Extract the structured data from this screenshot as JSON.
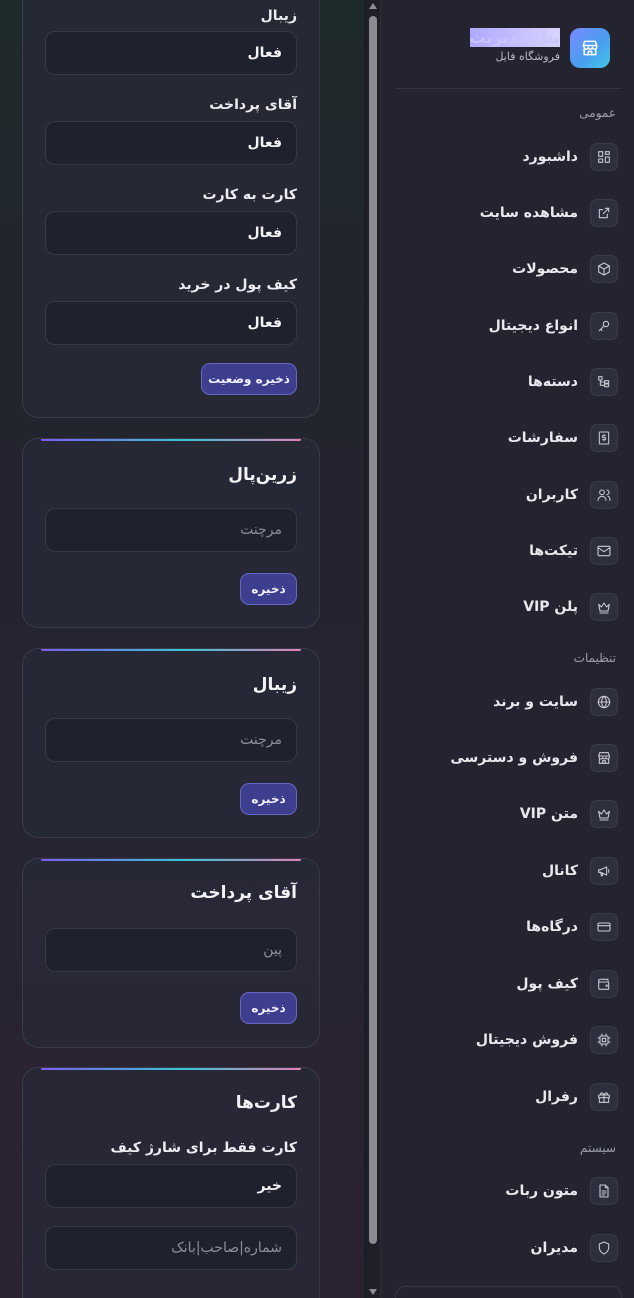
{
  "brand": {
    "title": "پنل مدیریت",
    "subtitle": "فروشگاه فایل"
  },
  "sidebar": {
    "sections": [
      {
        "label": "عمومی"
      },
      {
        "label": "تنظیمات"
      },
      {
        "label": "سیستم"
      }
    ],
    "items": [
      {
        "label": "داشبورد",
        "icon": "dashboard-icon"
      },
      {
        "label": "مشاهده سایت",
        "icon": "external-link-icon"
      },
      {
        "label": "محصولات",
        "icon": "box-icon"
      },
      {
        "label": "انواع دیجیتال",
        "icon": "key-icon"
      },
      {
        "label": "دسته‌ها",
        "icon": "category-tree-icon"
      },
      {
        "label": "سفارشات",
        "icon": "invoice-icon"
      },
      {
        "label": "کاربران",
        "icon": "users-icon"
      },
      {
        "label": "تیکت‌ها",
        "icon": "mail-icon"
      },
      {
        "label": "پلن VIP",
        "icon": "crown-icon"
      },
      {
        "label": "سایت و برند",
        "icon": "globe-icon"
      },
      {
        "label": "فروش و دسترسی",
        "icon": "store-icon"
      },
      {
        "label": "متن VIP",
        "icon": "crown-icon"
      },
      {
        "label": "کانال",
        "icon": "megaphone-icon"
      },
      {
        "label": "درگاه‌ها",
        "icon": "credit-card-icon"
      },
      {
        "label": "کیف پول",
        "icon": "wallet-icon"
      },
      {
        "label": "فروش دیجیتال",
        "icon": "chip-icon"
      },
      {
        "label": "رفرال",
        "icon": "gift-icon"
      },
      {
        "label": "متون ربات",
        "icon": "document-icon"
      },
      {
        "label": "مدیران",
        "icon": "shield-icon"
      }
    ]
  },
  "status_card": {
    "fields": [
      {
        "label": "زیبال",
        "value": "فعال"
      },
      {
        "label": "آقای پرداخت",
        "value": "فعال"
      },
      {
        "label": "کارت به کارت",
        "value": "فعال"
      },
      {
        "label": "کیف پول در خرید",
        "value": "فعال"
      }
    ],
    "save_label": "ذخیره وضعیت"
  },
  "gateway_cards": [
    {
      "title": "زرین‌پال",
      "placeholder": "مرچنت",
      "save_label": "ذخیره"
    },
    {
      "title": "زیبال",
      "placeholder": "مرچنت",
      "save_label": "ذخیره"
    },
    {
      "title": "آقای پرداخت",
      "placeholder": "پین",
      "save_label": "ذخیره"
    }
  ],
  "cards_card": {
    "title": "کارت‌ها",
    "field_label": "کارت فقط برای شارژ کیف",
    "field_value": "خیر",
    "second_placeholder": "شماره|صاحب|بانک"
  }
}
